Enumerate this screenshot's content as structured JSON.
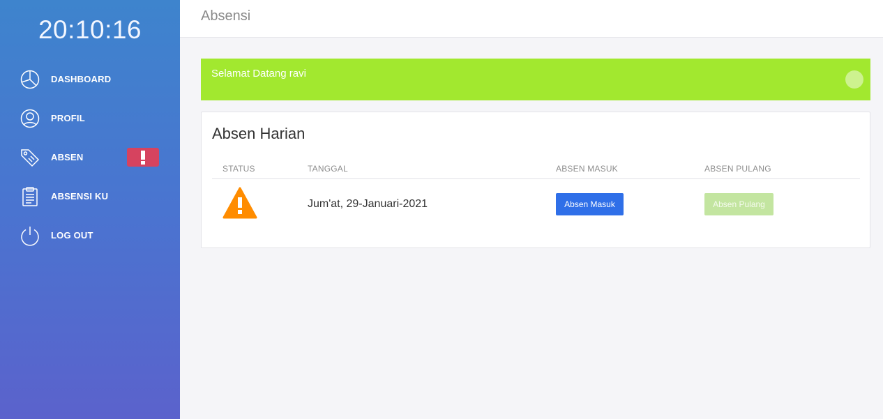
{
  "sidebar": {
    "clock": "20:10:16",
    "items": [
      {
        "label": "DASHBOARD",
        "icon": "pie-chart-icon"
      },
      {
        "label": "PROFIL",
        "icon": "user-icon"
      },
      {
        "label": "ABSEN",
        "icon": "tags-icon",
        "alert": true
      },
      {
        "label": "ABSENSI KU",
        "icon": "clipboard-icon"
      },
      {
        "label": "LOG OUT",
        "icon": "power-icon"
      }
    ],
    "alert_color": "#d6435f"
  },
  "topbar": {
    "title": "Absensi"
  },
  "welcome": {
    "text": "Selamat Datang ravi",
    "color": "#a2e82f"
  },
  "card": {
    "title": "Absen Harian",
    "columns": [
      "STATUS",
      "TANGGAL",
      "ABSEN MASUK",
      "ABSEN PULANG"
    ],
    "row": {
      "status_icon": "warning-icon",
      "date": "Jum'at, 29-Januari-2021",
      "masuk_label": "Absen Masuk",
      "pulang_label": "Absen Pulang"
    }
  },
  "colors": {
    "primary_button": "#2f6fe8",
    "disabled_success_button": "#c3e5a0",
    "warning": "#ff8c00"
  }
}
